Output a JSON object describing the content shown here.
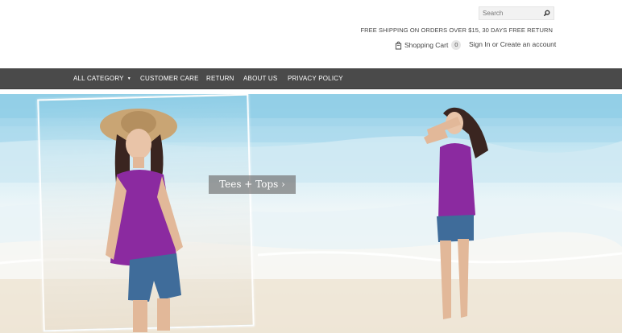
{
  "header": {
    "search_placeholder": "Search",
    "promo_text": "FREE SHIPPING ON ORDERS OVER $15, 30 DAYS FREE RETURN",
    "cart_label": "Shopping Cart",
    "cart_count": "0",
    "sign_in": "Sign In",
    "or_text": "or",
    "create_account": "Create an account"
  },
  "nav": {
    "items": [
      {
        "label": "ALL CATEGORY"
      },
      {
        "label": "CUSTOMER CARE"
      },
      {
        "label": "RETURN"
      },
      {
        "label": "ABOUT US"
      },
      {
        "label": "PRIVACY POLICY"
      }
    ],
    "background": "#4a4a4a"
  },
  "hero": {
    "banner_text": "Tees + Tops ›",
    "accent_shirt_color": "#8b2aa0",
    "shorts_color": "#3f6c9a"
  },
  "icons": [
    "search-icon",
    "shopping-bag-icon",
    "chevron-down-icon"
  ]
}
